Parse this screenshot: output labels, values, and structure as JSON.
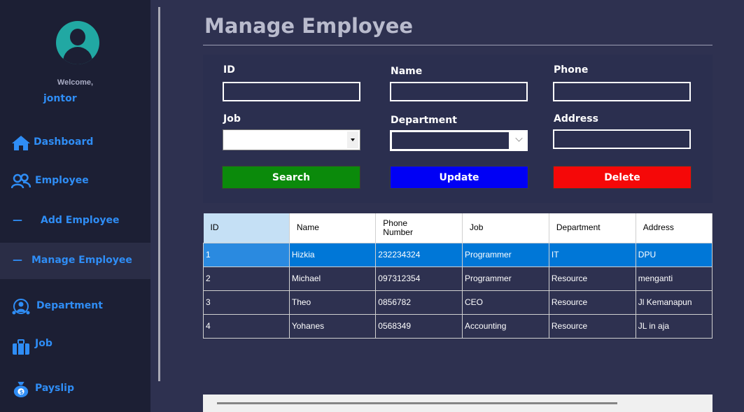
{
  "sidebar": {
    "welcome": "Welcome,",
    "username": "jontor",
    "items": [
      {
        "label": "Dashboard",
        "icon": "home-icon"
      },
      {
        "label": "Employee",
        "icon": "users-icon"
      },
      {
        "label": "Add Employee",
        "prefix": "—"
      },
      {
        "label": "Manage Employee",
        "prefix": "—",
        "active": true
      },
      {
        "label": "Department",
        "icon": "department-icon"
      },
      {
        "label": "Job",
        "icon": "briefcase-icon"
      },
      {
        "label": "Payslip",
        "icon": "money-bag-icon"
      }
    ]
  },
  "main": {
    "title": "Manage Employee",
    "form": {
      "id_label": "ID",
      "name_label": "Name",
      "phone_label": "Phone",
      "job_label": "Job",
      "department_label": "Department",
      "address_label": "Address",
      "id_value": "",
      "name_value": "",
      "phone_value": "",
      "job_value": "",
      "department_value": "",
      "address_value": "",
      "search_label": "Search",
      "update_label": "Update",
      "delete_label": "Delete"
    },
    "grid": {
      "columns": [
        "ID",
        "Name",
        "Phone\nNumber",
        "Job",
        "Department",
        "Address"
      ],
      "rows": [
        [
          "1",
          "Hizkia",
          "232234324",
          "Programmer",
          "IT",
          "DPU"
        ],
        [
          "2",
          "Michael",
          "097312354",
          "Programmer",
          "Resource",
          "menganti"
        ],
        [
          "3",
          "Theo",
          "0856782",
          "CEO",
          "Resource",
          "Jl Kemanapun"
        ],
        [
          "4",
          "Yohanes",
          "0568349",
          "Accounting",
          "Resource",
          "JL in aja"
        ]
      ],
      "selected_row": 0
    }
  },
  "colors": {
    "sidebar_bg": "#1c1f34",
    "main_bg": "#2e3150",
    "accent_blue": "#2f8df5",
    "search_green": "#0b8a0b",
    "update_blue": "#0000f5",
    "delete_red": "#f50808",
    "selected_row": "#0077d7"
  }
}
